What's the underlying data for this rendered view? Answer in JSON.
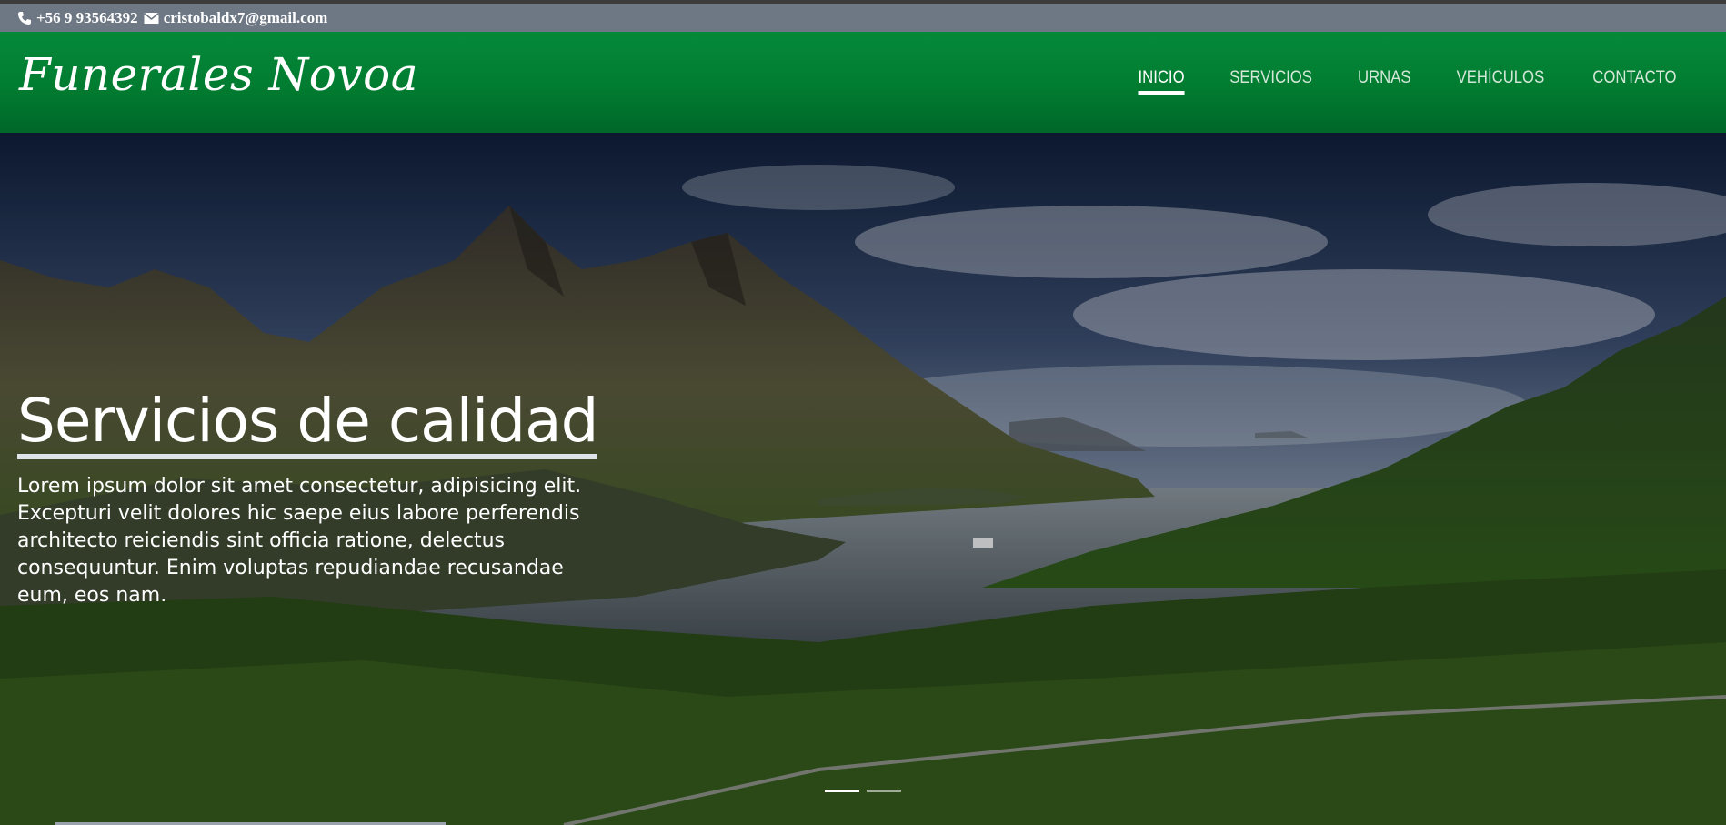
{
  "contact": {
    "phone": "+56 9 93564392",
    "email": "cristobaldx7@gmail.com",
    "phone_icon": "phone-icon",
    "email_icon": "envelope-icon"
  },
  "navbar": {
    "brand": "Funerales Novoa",
    "links": [
      {
        "label": "INICIO",
        "active": true
      },
      {
        "label": "SERVICIOS",
        "active": false
      },
      {
        "label": "URNAS",
        "active": false
      },
      {
        "label": "VEHÍCULOS",
        "active": false
      },
      {
        "label": "CONTACTO",
        "active": false
      }
    ]
  },
  "hero": {
    "title": "Servicios de calidad",
    "text": "Lorem ipsum dolor sit amet consectetur, adipisicing elit. Excepturi velit dolores hic saepe eius labore perferendis architecto reiciendis sint officia ratione, delectus consequuntur. Enim voluptas repudiandae recusandae eum, eos nam.",
    "slides": 2,
    "active_slide": 1
  },
  "colors": {
    "navbar": "#017c30",
    "contact_bar": "#6e7884",
    "text": "#ffffff"
  }
}
